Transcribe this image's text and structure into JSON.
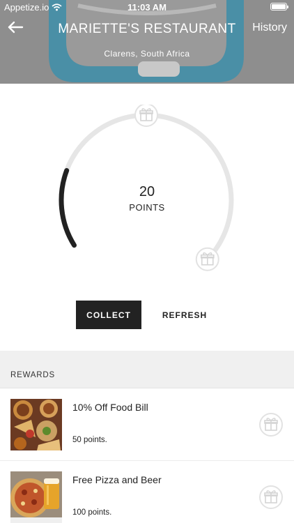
{
  "status_bar": {
    "carrier": "Appetize.io",
    "time": "11:03 AM"
  },
  "header": {
    "title": "MARIETTE'S RESTAURANT",
    "subtitle": "Clarens, South Africa",
    "history_label": "History"
  },
  "points": {
    "value": "20",
    "label": "POINTS",
    "progress_fraction": 0.2
  },
  "actions": {
    "collect_label": "COLLECT",
    "refresh_label": "REFRESH"
  },
  "rewards": {
    "heading": "REWARDS",
    "items": [
      {
        "title": "10% Off Food Bill",
        "points": "50 points.",
        "icon": "gift-icon"
      },
      {
        "title": "Free Pizza and Beer",
        "points": "100 points.",
        "icon": "gift-icon"
      }
    ]
  },
  "colors": {
    "header_overlay": "#8c8c8c",
    "logo_blue": "#3fa7c9",
    "ring_track": "#e6e6e6",
    "ring_progress": "#222222",
    "button_dark": "#222222"
  }
}
